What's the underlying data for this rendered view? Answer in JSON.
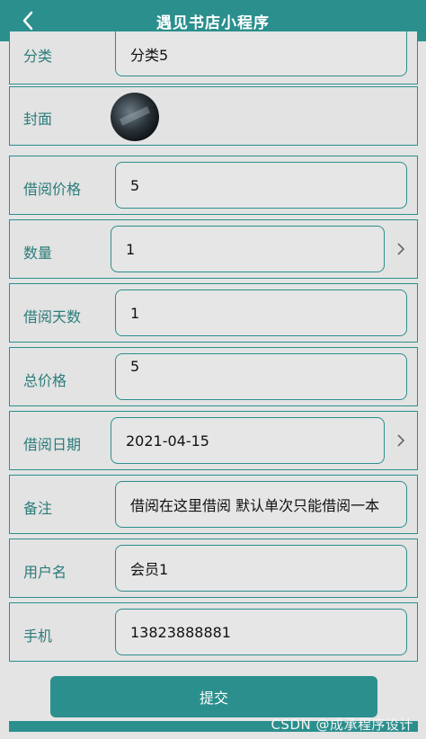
{
  "header": {
    "title": "遇见书店小程序"
  },
  "form": {
    "category": {
      "label": "分类",
      "value": "分类5"
    },
    "cover": {
      "label": "封面"
    },
    "borrow_price": {
      "label": "借阅价格",
      "value": "5"
    },
    "quantity": {
      "label": "数量",
      "value": "1"
    },
    "borrow_days": {
      "label": "借阅天数",
      "value": "1"
    },
    "total_price": {
      "label": "总价格",
      "value": "5"
    },
    "borrow_date": {
      "label": "借阅日期",
      "value": "2021-04-15"
    },
    "remark": {
      "label": "备注",
      "value": "借阅在这里借阅  默认单次只能借阅一本"
    },
    "username": {
      "label": "用户名",
      "value": "会员1"
    },
    "phone": {
      "label": "手机",
      "value": "13823888881"
    }
  },
  "actions": {
    "submit_label": "提交"
  },
  "watermark": "CSDN @成承程序设计",
  "colors": {
    "accent": "#2b8f8d",
    "background": "#e4e4e4"
  },
  "icons": [
    "back-icon",
    "chevron-right-icon"
  ]
}
